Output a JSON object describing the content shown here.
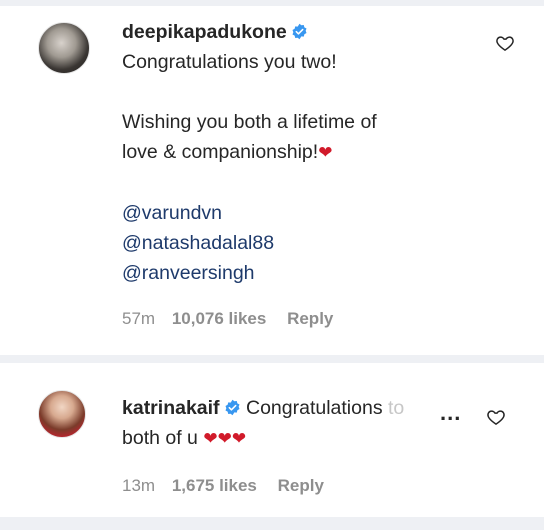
{
  "comments": [
    {
      "username": "deepikapadukone",
      "lines": [
        "Congratulations you two!",
        "",
        "Wishing you both a lifetime of",
        "love & companionship!"
      ],
      "heart": "❤",
      "mentions": [
        "@varundvn",
        "@natashadalal88",
        "@ranveersingh"
      ],
      "time": "57m",
      "likes": "10,076 likes",
      "reply": "Reply"
    },
    {
      "username": "katrinakaif",
      "text_line1": "Congratulations",
      "truncated_hint": "to",
      "more": "...",
      "text_line2": "both of u",
      "hearts": "❤❤❤",
      "time": "13m",
      "likes": "1,675 likes",
      "reply": "Reply"
    }
  ],
  "icons": {
    "verified": "verified-badge-icon",
    "like": "heart-outline-icon",
    "more": "ellipsis-icon"
  },
  "colors": {
    "verified": "#3897f0",
    "mention": "#1e3a6b",
    "heart": "#d11a2a",
    "meta": "#8e8e8e",
    "divider": "#eef0f4"
  }
}
